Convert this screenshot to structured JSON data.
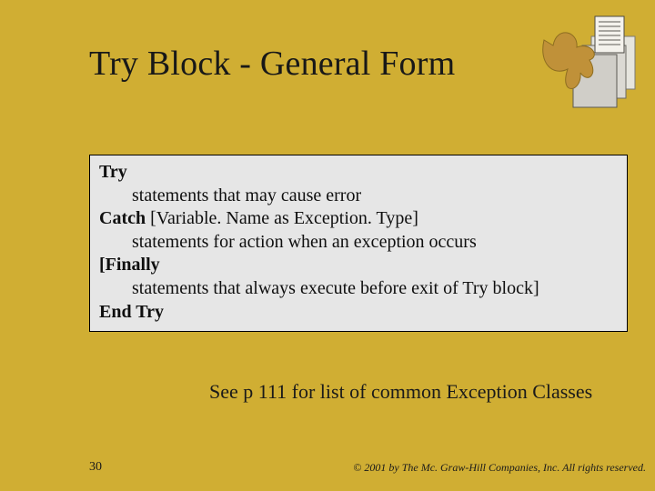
{
  "title": "Try Block - General Form",
  "code": {
    "kw_try": "Try",
    "try_line": "statements that may cause error",
    "kw_catch": "Catch",
    "catch_args": " [Variable. Name as Exception. Type]",
    "catch_line": "statements for action when an exception occurs",
    "kw_finally": "[Finally",
    "finally_line": "statements that always execute before exit of Try block]",
    "kw_end": "End Try"
  },
  "note": "See p 111 for list of common Exception Classes",
  "page_number": "30",
  "copyright": "© 2001 by The Mc. Graw-Hill Companies, Inc. All rights reserved."
}
